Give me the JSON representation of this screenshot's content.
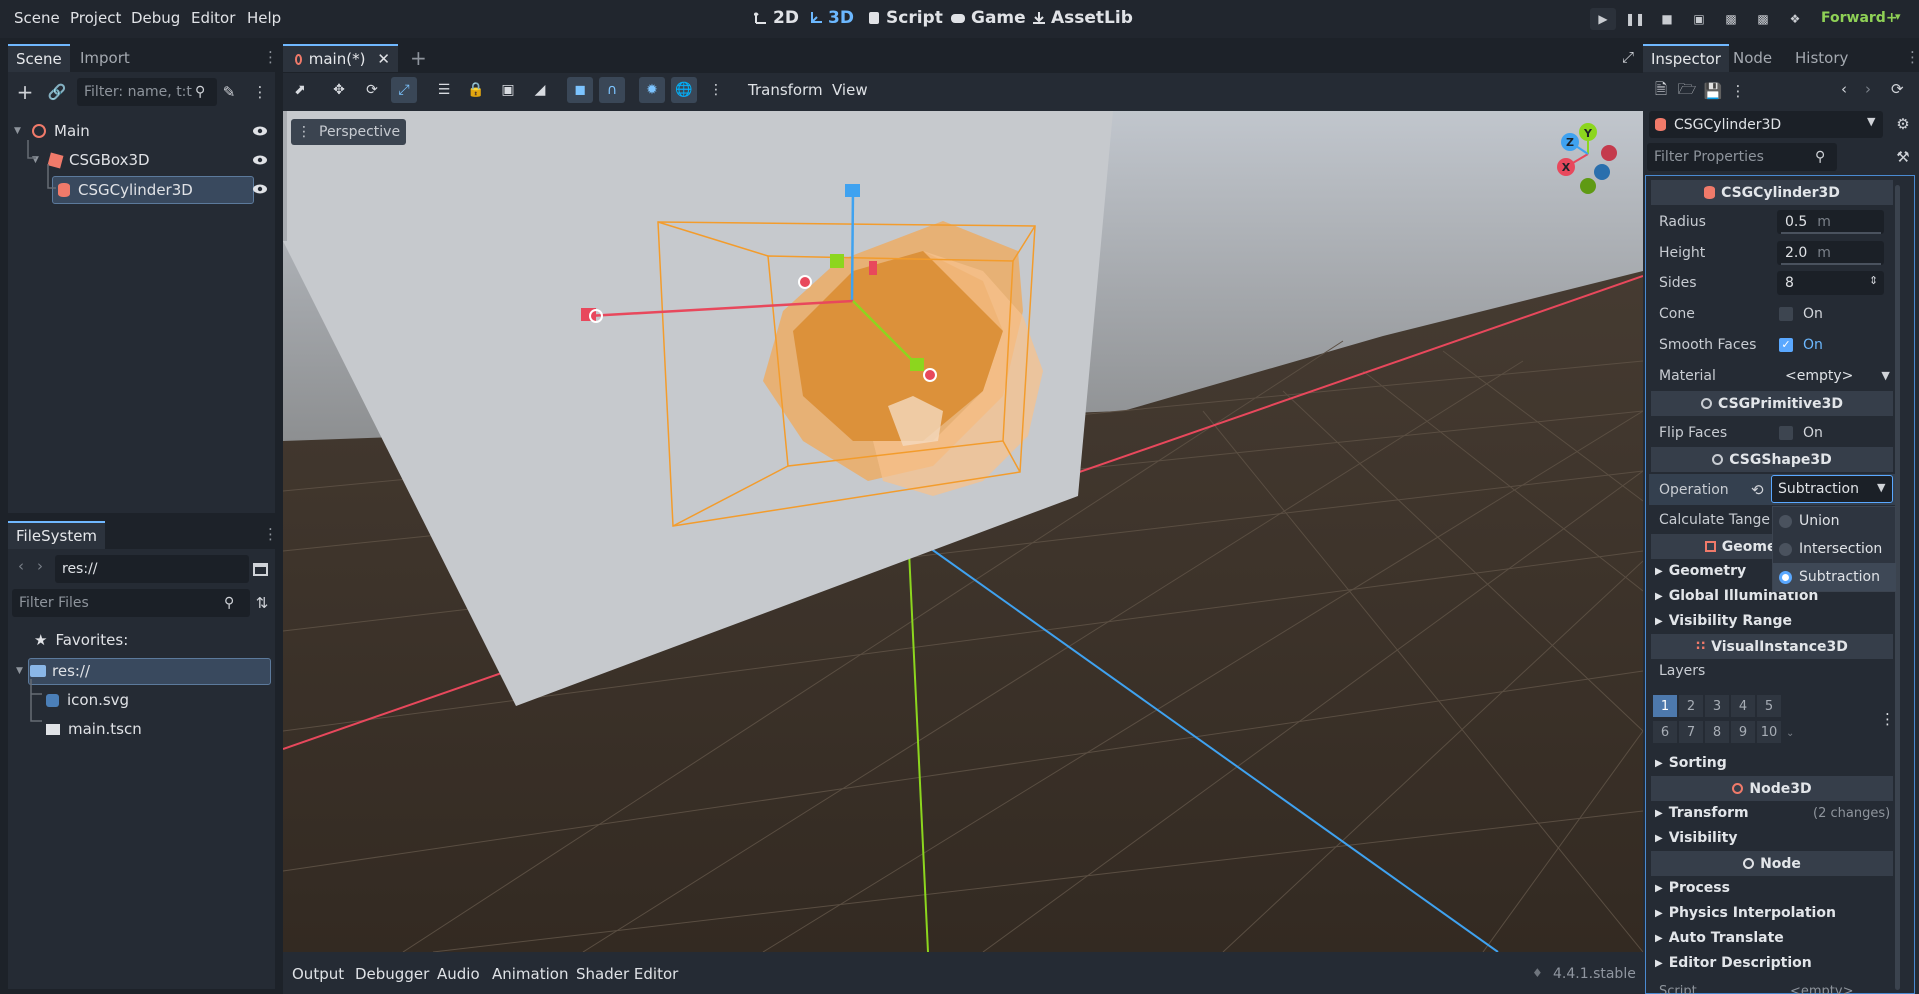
{
  "menu": [
    "Scene",
    "Project",
    "Debug",
    "Editor",
    "Help"
  ],
  "workspaces": {
    "w2d": "2D",
    "w3d": "3D",
    "script": "Script",
    "game": "Game",
    "assetlib": "AssetLib"
  },
  "renderer": "Forward+",
  "scene_dock": {
    "tabs": {
      "scene": "Scene",
      "import": "Import"
    },
    "filter_placeholder": "Filter: name, t:t",
    "nodes": {
      "main": "Main",
      "box": "CSGBox3D",
      "cyl": "CSGCylinder3D"
    }
  },
  "filesystem": {
    "tab": "FileSystem",
    "path": "res://",
    "filter_placeholder": "Filter Files",
    "favorites": "Favorites:",
    "root": "res://",
    "files": [
      "icon.svg",
      "main.tscn"
    ]
  },
  "editor_tab": "main(*)",
  "toolbar": {
    "transform": "Transform",
    "view": "View"
  },
  "viewport": {
    "perspective": "Perspective",
    "gizmo": {
      "x": "X",
      "y": "Y",
      "z": "Z"
    }
  },
  "inspector": {
    "tabs": {
      "inspector": "Inspector",
      "node": "Node",
      "history": "History"
    },
    "object": "CSGCylinder3D",
    "filter_placeholder": "Filter Properties",
    "cyl_section": "CSGCylinder3D",
    "radius": {
      "label": "Radius",
      "value": "0.5",
      "unit": "m"
    },
    "height": {
      "label": "Height",
      "value": "2.0",
      "unit": "m"
    },
    "sides": {
      "label": "Sides",
      "value": "8"
    },
    "cone": {
      "label": "Cone",
      "value": "On"
    },
    "smooth": {
      "label": "Smooth Faces",
      "value": "On"
    },
    "material": {
      "label": "Material",
      "value": "<empty>"
    },
    "prim_section": "CSGPrimitive3D",
    "flip": {
      "label": "Flip Faces",
      "value": "On"
    },
    "shape_section": "CSGShape3D",
    "operation": {
      "label": "Operation",
      "value": "Subtraction"
    },
    "calc": {
      "label": "Calculate Tange"
    },
    "geom_section": "Geometry",
    "groups1": [
      "Geometry",
      "Global Illumination",
      "Visibility Range"
    ],
    "vis_section": "VisualInstance3D",
    "layers_label": "Layers",
    "layers": [
      "1",
      "2",
      "3",
      "4",
      "5",
      "6",
      "7",
      "8",
      "9",
      "10"
    ],
    "sorting": "Sorting",
    "node3d_section": "Node3D",
    "transform": "Transform",
    "transform_changes": "(2 changes)",
    "visibility": "Visibility",
    "node_section": "Node",
    "groups2": [
      "Process",
      "Physics Interpolation",
      "Auto Translate",
      "Editor Description"
    ],
    "cut_label": "Script",
    "cut_value": "<empty>"
  },
  "dropdown": [
    "Union",
    "Intersection",
    "Subtraction"
  ],
  "bottom": {
    "tabs": [
      "Output",
      "Debugger",
      "Audio",
      "Animation",
      "Shader Editor"
    ],
    "version": "4.4.1.stable"
  },
  "colors": {
    "accent": "#5aa8ff",
    "panel": "#252b34",
    "x_axis": "#e8485c",
    "y_axis": "#8cd61e",
    "z_axis": "#3fa2f0",
    "selection": "#f39c2c"
  }
}
